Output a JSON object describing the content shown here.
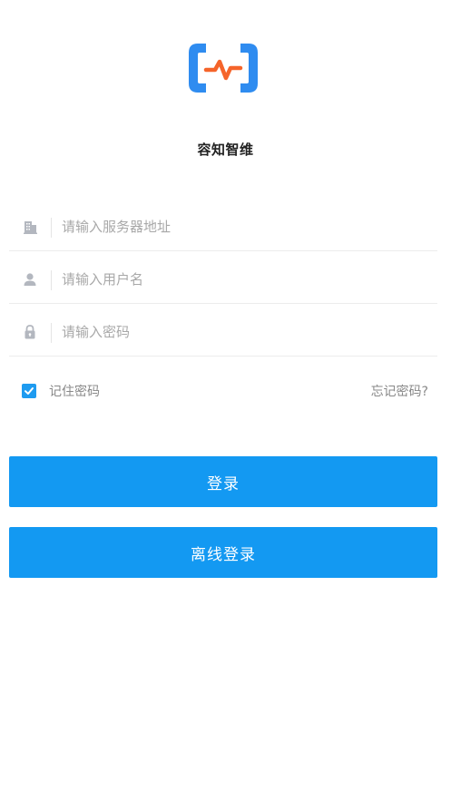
{
  "app": {
    "name": "容知智维"
  },
  "form": {
    "server_placeholder": "请输入服务器地址",
    "username_placeholder": "请输入用户名",
    "password_placeholder": "请输入密码",
    "remember_label": "记住密码",
    "remember_checked": true,
    "forgot_label": "忘记密码?"
  },
  "buttons": {
    "login_label": "登录",
    "offline_login_label": "离线登录"
  },
  "icons": {
    "logo": "pulse-logo-icon",
    "server": "building-icon",
    "user": "user-icon",
    "password": "lock-icon",
    "checkbox": "check-icon"
  },
  "colors": {
    "brand_blue": "#1399f2",
    "logo_blue": "#2f8cf0",
    "logo_orange": "#f5642a",
    "placeholder_gray": "#a8a8a8",
    "icon_gray": "#b3b7bf"
  }
}
